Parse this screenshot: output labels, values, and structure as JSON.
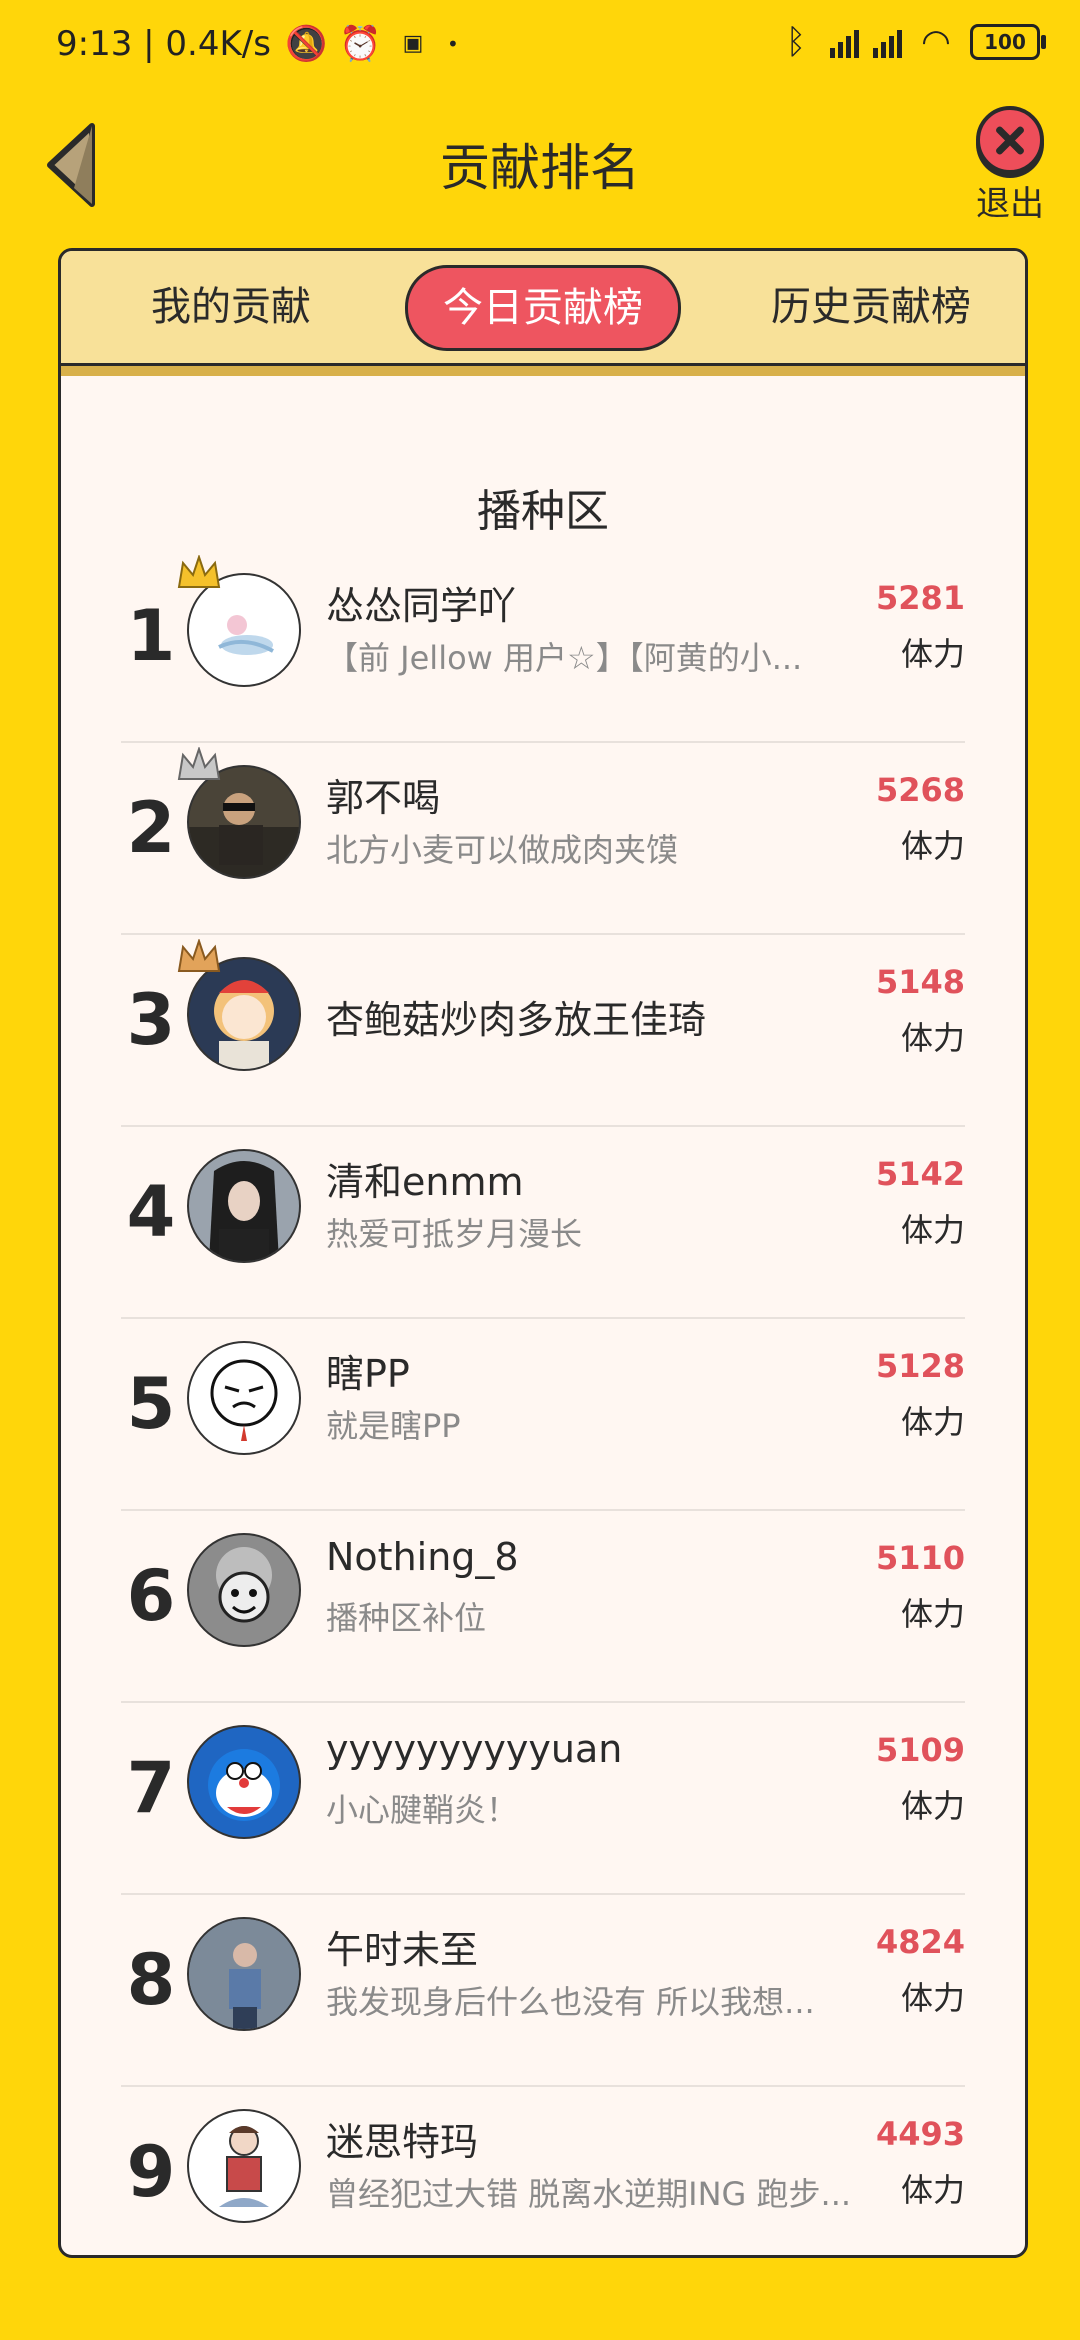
{
  "status": {
    "time_speed": "9:13 | 0.4K/s",
    "battery": "100"
  },
  "header": {
    "title": "贡献排名",
    "exit_label": "退出"
  },
  "tabs": [
    {
      "label": "我的贡献"
    },
    {
      "label": "今日贡献榜"
    },
    {
      "label": "历史贡献榜"
    }
  ],
  "section_title": "播种区",
  "rows": [
    {
      "rank": "1",
      "name": "怂怂同学吖",
      "bio": "【前 Jellow 用户☆】【阿黄的小...",
      "score": "5281",
      "unit": "体力"
    },
    {
      "rank": "2",
      "name": "郭不喝",
      "bio": "北方小麦可以做成肉夹馍",
      "score": "5268",
      "unit": "体力"
    },
    {
      "rank": "3",
      "name": "杏鲍菇炒肉多放王佳琦",
      "bio": "",
      "score": "5148",
      "unit": "体力"
    },
    {
      "rank": "4",
      "name": "清和enmm",
      "bio": "热爱可抵岁月漫长",
      "score": "5142",
      "unit": "体力"
    },
    {
      "rank": "5",
      "name": "瞎PP",
      "bio": "就是瞎PP",
      "score": "5128",
      "unit": "体力"
    },
    {
      "rank": "6",
      "name": "Nothing_8",
      "bio": "播种区补位",
      "score": "5110",
      "unit": "体力"
    },
    {
      "rank": "7",
      "name": "yyyyyyyyyyuan",
      "bio": "小心腱鞘炎！",
      "score": "5109",
      "unit": "体力"
    },
    {
      "rank": "8",
      "name": "午时未至",
      "bio": "我发现身后什么也没有 所以我想...",
      "score": "4824",
      "unit": "体力"
    },
    {
      "rank": "9",
      "name": "迷思特玛",
      "bio": "曾经犯过大错 脱离水逆期ING 跑步...",
      "score": "4493",
      "unit": "体力"
    }
  ]
}
